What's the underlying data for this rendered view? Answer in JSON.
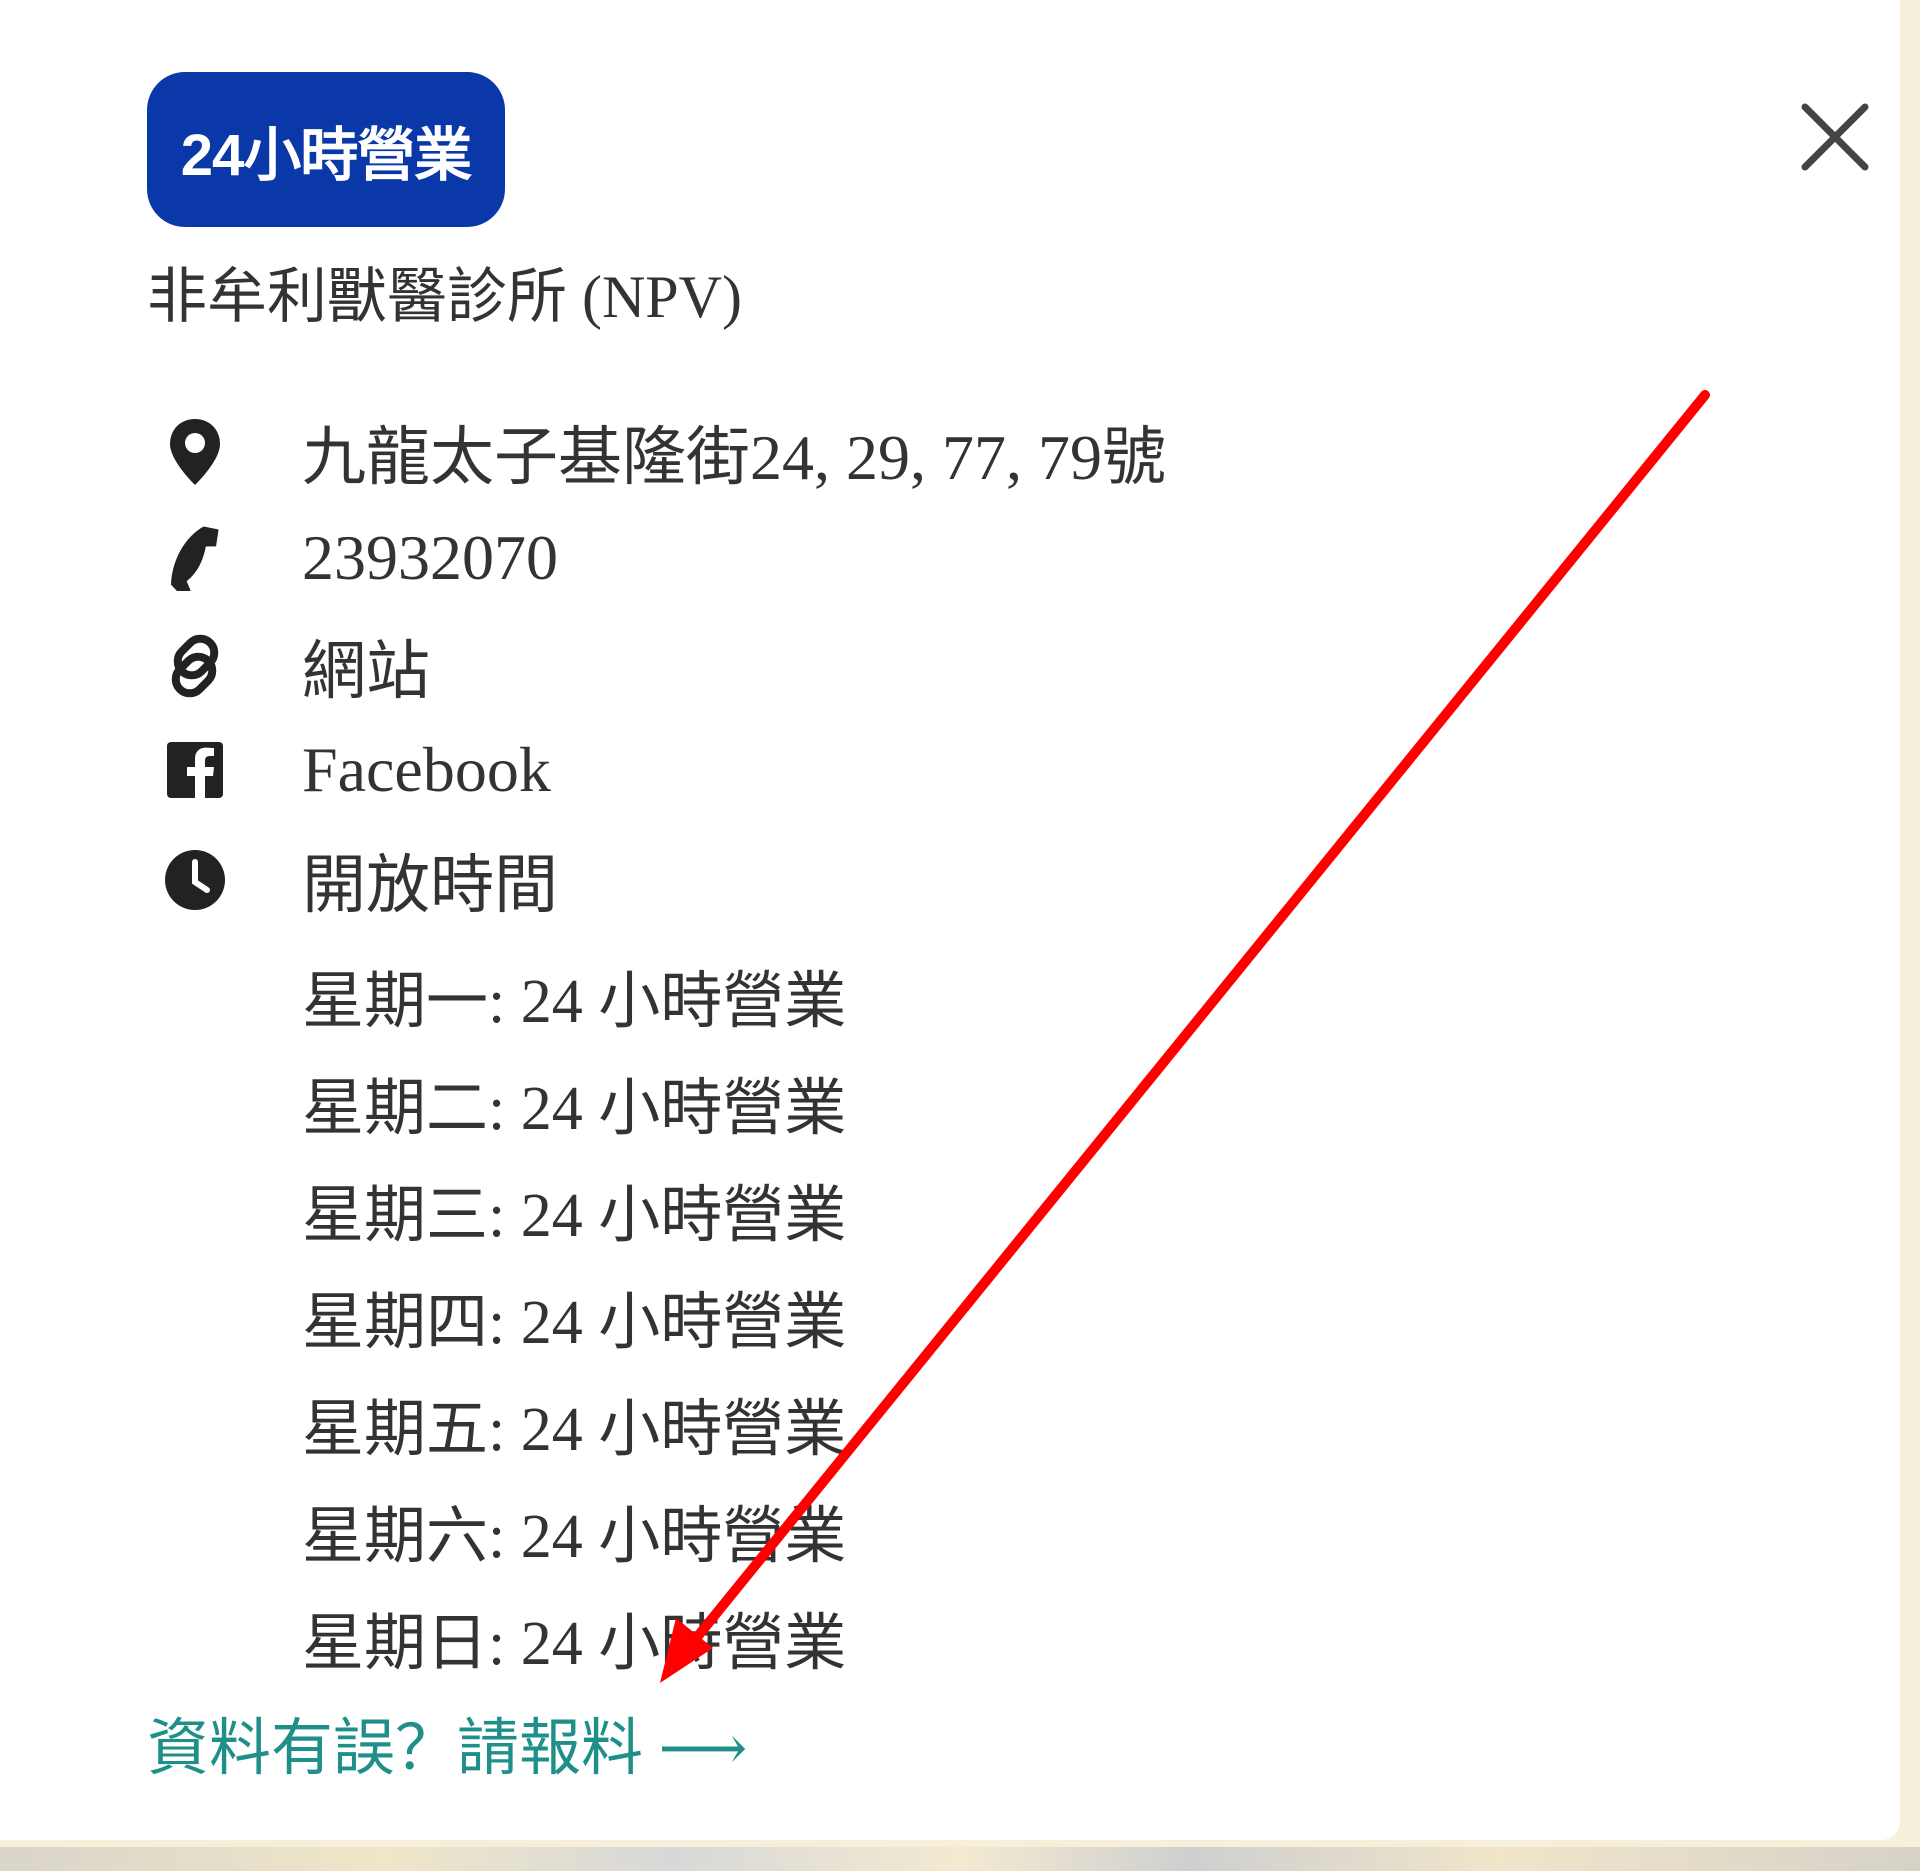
{
  "badge": "24小時營業",
  "clinic_name": "非牟利獸醫診所 (NPV)",
  "address": "九龍太子基隆街24, 29, 77, 79號",
  "phone": "23932070",
  "website_label": "網站",
  "facebook_label": "Facebook",
  "hours_label": "開放時間",
  "hours": [
    "星期一: 24 小時營業",
    "星期二: 24 小時營業",
    "星期三: 24 小時營業",
    "星期四: 24 小時營業",
    "星期五: 24 小時營業",
    "星期六: 24 小時營業",
    "星期日: 24 小時營業"
  ],
  "report_link": "資料有誤？請報料 ⟶",
  "icons": {
    "close": "close-icon",
    "address": "location-pin-icon",
    "phone": "phone-icon",
    "website": "link-icon",
    "facebook": "facebook-icon",
    "hours": "clock-icon"
  },
  "colors": {
    "badge_bg": "#0b38a8",
    "link": "#1f8f8a",
    "annotation_arrow": "#ff0000"
  }
}
